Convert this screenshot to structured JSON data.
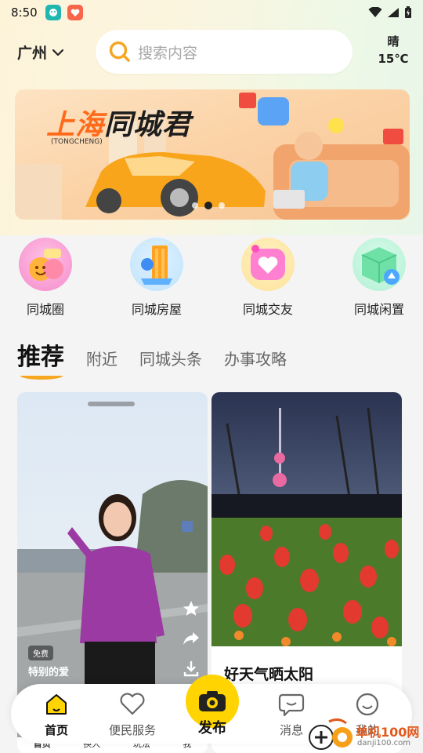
{
  "status_bar": {
    "time": "8:50"
  },
  "header": {
    "city": "广州",
    "search_placeholder": "搜索内容",
    "weather": {
      "condition": "晴",
      "temperature": "15℃"
    }
  },
  "banner": {
    "title_city": "上海",
    "title_rest": "同城君",
    "sub": "(TONGCHENG)",
    "slides": 3,
    "active_slide": 2
  },
  "categories": [
    {
      "label": "同城圈",
      "icon": "faces-icon"
    },
    {
      "label": "同城房屋",
      "icon": "building-icon"
    },
    {
      "label": "同城交友",
      "icon": "heart-chat-icon"
    },
    {
      "label": "同城闲置",
      "icon": "box-icon"
    }
  ],
  "tabs": [
    {
      "label": "推荐",
      "active": true
    },
    {
      "label": "附近",
      "active": false
    },
    {
      "label": "同城头条",
      "active": false
    },
    {
      "label": "办事攻略",
      "active": false
    }
  ],
  "feed": {
    "left_card": {
      "badge": "免费",
      "title": "特别的爱",
      "mini_nav": [
        "首页",
        "换人",
        "玩法",
        "我"
      ]
    },
    "right_card": {
      "caption": "好天气晒太阳"
    }
  },
  "bottom_nav": {
    "items": [
      {
        "label": "首页",
        "icon": "home-icon",
        "active": true
      },
      {
        "label": "便民服务",
        "icon": "heart-outline-icon",
        "active": false
      },
      {
        "label": "消息",
        "icon": "chat-bubble-icon",
        "active": false
      },
      {
        "label": "我的",
        "icon": "smile-face-icon",
        "active": false
      }
    ],
    "publish_label": "发布"
  },
  "watermark": {
    "text": "单机100网",
    "url": "danji100.com"
  },
  "colors": {
    "accent": "#ffd400",
    "tab_underline": "#f7a820",
    "search_icon": "#f5a623"
  }
}
